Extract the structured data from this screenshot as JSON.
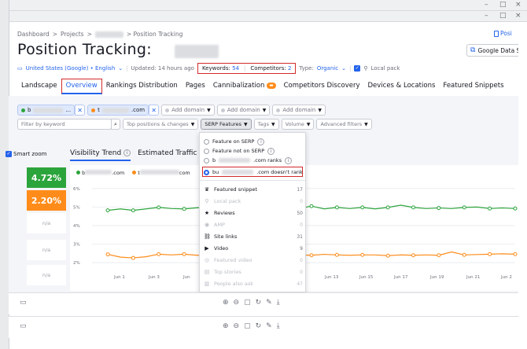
{
  "window": {
    "minimize": "–",
    "restore": "□",
    "close": "×"
  },
  "breadcrumb": [
    "Dashboard",
    ">",
    "Projects",
    ">",
    "> Position Tracking"
  ],
  "header": {
    "title": "Position Tracking:",
    "top_right_link": "Posi",
    "google_button": "Google Data St"
  },
  "info": {
    "location": "United States (Google) • English",
    "updated": "Updated: 14 hours ago",
    "keywords": "Keywords: 54",
    "competitors": "Competitors: 2",
    "type_label": "Type:",
    "type_value": "Organic",
    "local_pack": "Local pack"
  },
  "tabs": [
    "Landscape",
    "Overview",
    "Rankings Distribution",
    "Pages",
    "Cannibalization",
    "Competitors Discovery",
    "Devices & Locations",
    "Featured Snippets"
  ],
  "domains": [
    {
      "name": "b",
      "suffix": "...",
      "color": "#2ca43c"
    },
    {
      "name": "t",
      "suffix": ".com",
      "color": "#ff8c1a"
    }
  ],
  "add_domain": "Add domain",
  "filters": {
    "keyword_placeholder": "Filter by keyword",
    "top_positions": "Top positions & changes",
    "serp_features": "SERP Features",
    "tags": "Tags",
    "volume": "Volume",
    "advanced": "Advanced filters"
  },
  "dropdown": {
    "options": [
      "Feature on SERP",
      "Feature not on SERP",
      "b",
      "bu"
    ],
    "option_suffixes": [
      "",
      "",
      ".com ranks",
      ".com doesn't rank"
    ],
    "items": [
      {
        "label": "Featured snippet",
        "count": "17",
        "icon": "♛",
        "disabled": false
      },
      {
        "label": "Local pack",
        "count": "0",
        "icon": "⚲",
        "disabled": true
      },
      {
        "label": "Reviews",
        "count": "50",
        "icon": "★",
        "disabled": false
      },
      {
        "label": "AMP",
        "count": "0",
        "icon": "◉",
        "disabled": true
      },
      {
        "label": "Site links",
        "count": "31",
        "icon": "⛓",
        "disabled": false
      },
      {
        "label": "Video",
        "count": "9",
        "icon": "▶",
        "disabled": false
      },
      {
        "label": "Featured video",
        "count": "0",
        "icon": "◎",
        "disabled": true
      },
      {
        "label": "Top stories",
        "count": "0",
        "icon": "▤",
        "disabled": true
      },
      {
        "label": "People also ask",
        "count": "47",
        "icon": "▥",
        "disabled": true
      }
    ]
  },
  "visibility": {
    "smart_zoom": "Smart zoom",
    "tab_visibility": "Visibility Trend",
    "tab_traffic": "Estimated Traffic",
    "kpi_green": "4.72%",
    "kpi_orange": "2.20%",
    "na": "n/a"
  },
  "chart_data": {
    "type": "line",
    "x": [
      "Jun 1",
      "Jun 3",
      "Jun 5",
      "Jun 7",
      "Jun 9",
      "Jun 11",
      "Jun 13",
      "Jun 15",
      "Jun 17",
      "Jun 19",
      "Jun 21",
      "Jun 23"
    ],
    "x_visible_labels": [
      "Jun 1",
      "Jun 3",
      "Jun",
      "Jun 13",
      "Jun 15",
      "Jun 17",
      "Jun 19",
      "Jun 21",
      "Jun 2"
    ],
    "ylim": [
      1.5,
      6.5
    ],
    "yticks": [
      "6%",
      "5%",
      "4%",
      "3%",
      "2%"
    ],
    "series": [
      {
        "name": "b…com",
        "color": "#2ca43c",
        "values": [
          4.82,
          4.9,
          4.82,
          4.9,
          4.98,
          4.92,
          4.9,
          4.96,
          4.98,
          4.94,
          4.9,
          5.0,
          4.92,
          4.95,
          5.0,
          4.92,
          5.05,
          4.9,
          4.98,
          4.92,
          4.98,
          4.9,
          4.98,
          5.1,
          4.98,
          4.92,
          4.95,
          4.92,
          4.98,
          5.0,
          4.92,
          4.95,
          4.92
        ]
      },
      {
        "name": "t…com",
        "color": "#ff8c1a",
        "values": [
          2.45,
          2.3,
          2.26,
          2.32,
          2.46,
          2.42,
          2.46,
          2.4,
          2.42,
          2.44,
          2.4,
          2.36,
          2.44,
          2.4,
          2.45,
          2.42,
          2.4,
          2.45,
          2.42,
          2.4,
          2.42,
          2.42,
          2.38,
          2.42,
          2.4,
          2.42,
          2.4,
          2.58,
          2.42,
          2.44,
          2.46,
          2.48,
          2.46
        ]
      }
    ]
  },
  "legend": {
    "green_suffix": ".com",
    "orange_suffix": "com"
  },
  "toolbar": {
    "icons": [
      "⊕",
      "⊖",
      "▢",
      "↻",
      "✎",
      "⤓"
    ]
  }
}
